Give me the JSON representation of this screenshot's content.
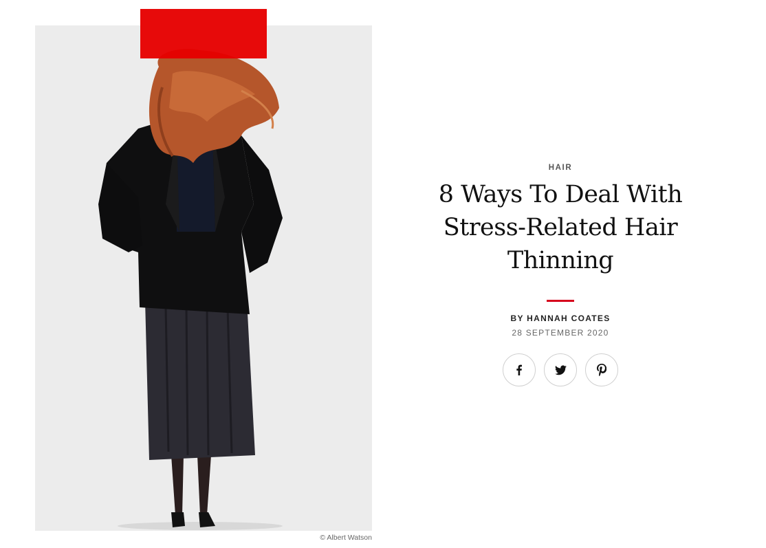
{
  "hero": {
    "image_alt": "Woman with windswept red hair in black jacket and long skirt",
    "credit": "© Albert Watson"
  },
  "article": {
    "category": "HAIR",
    "headline": "8 Ways To Deal With Stress-Related Hair Thinning",
    "byline": "BY HANNAH COATES",
    "date": "28 SEPTEMBER 2020"
  },
  "share": {
    "icons": [
      "facebook-icon",
      "twitter-icon",
      "pinterest-icon"
    ]
  },
  "colors": {
    "accent": "#d6001c",
    "overlay_red": "#e60000",
    "image_bg": "#ececec"
  }
}
